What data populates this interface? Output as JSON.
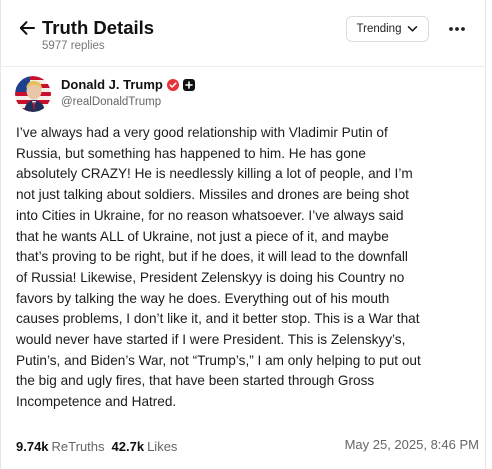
{
  "header": {
    "title": "Truth Details",
    "replies": "5977 replies",
    "sort_label": "Trending"
  },
  "post": {
    "author_name": "Donald J. Trump",
    "author_handle": "@realDonaldTrump",
    "text": "I’ve always had a very good relationship with Vladimir Putin of\nRussia, but something has happened to him. He has gone\nabsolutely CRAZY! He is needlessly killing a lot of people, and I’m\nnot just talking about soldiers. Missiles and drones are being shot\ninto Cities in Ukraine, for no reason whatsoever. I’ve always said\nthat he wants ALL of Ukraine, not just a piece of it, and maybe\nthat’s proving to be right, but if he does, it will lead to the downfall\nof Russia! Likewise, President Zelenskyy is doing his Country no\nfavors by talking the way he does. Everything out of his mouth\ncauses problems, I don’t like it, and it better stop. This is a War that\nwould never have started if I were President. This is Zelenskyy’s,\nPutin’s, and Biden’s War, not “Trump’s,” I am only helping to put out\nthe big and ugly fires, that have been started through Gross\nIncompetence and Hatred.",
    "retruths_count": "9.74k",
    "retruths_label": "ReTruths",
    "likes_count": "42.7k",
    "likes_label": "Likes",
    "timestamp": "May 25, 2025, 8:46 PM"
  },
  "colors": {
    "verified_badge": "#e5323b",
    "avatar_flag_red": "#c8102e",
    "avatar_flag_blue": "#1f3f8f"
  },
  "icons": {
    "back": "arrow-left-icon",
    "sort": "chevron-down-icon",
    "more": "more-dots-icon",
    "verified": "verified-badge-icon",
    "plus": "plus-badge-icon"
  }
}
